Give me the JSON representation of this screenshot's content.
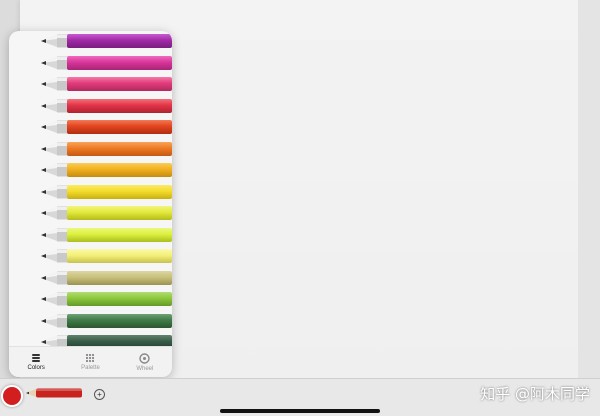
{
  "palette": {
    "pencils": [
      {
        "color": "#a02aa6",
        "light": "#c85ad0",
        "dark": "#7a1d80"
      },
      {
        "color": "#d8359a",
        "light": "#ee6cbc",
        "dark": "#a82476"
      },
      {
        "color": "#e23a7c",
        "light": "#f47aa4",
        "dark": "#b02a5e"
      },
      {
        "color": "#e23448",
        "light": "#f2707a",
        "dark": "#b0222f"
      },
      {
        "color": "#e2441f",
        "light": "#f27a56",
        "dark": "#b02e10"
      },
      {
        "color": "#ef7a24",
        "light": "#f7a45a",
        "dark": "#c35a12"
      },
      {
        "color": "#f2b01f",
        "light": "#f8cd5a",
        "dark": "#c48c10"
      },
      {
        "color": "#f4dc2a",
        "light": "#f9ea6a",
        "dark": "#c8b014"
      },
      {
        "color": "#e4ea3a",
        "light": "#f1f47e",
        "dark": "#b4ba1c"
      },
      {
        "color": "#dcf03e",
        "light": "#ecf87e",
        "dark": "#aabe20"
      },
      {
        "color": "#f4f07a",
        "light": "#fafaa8",
        "dark": "#c8c24e"
      },
      {
        "color": "#c8c07a",
        "light": "#dcd6a2",
        "dark": "#9a9252"
      },
      {
        "color": "#8cc83a",
        "light": "#b2dc74",
        "dark": "#64982a"
      },
      {
        "color": "#3f7a46",
        "light": "#6ea276",
        "dark": "#2a5630"
      },
      {
        "color": "#385c48",
        "light": "#62846e",
        "dark": "#223e30"
      }
    ]
  },
  "tabs": [
    {
      "label": "Colors",
      "icon": "stack-icon",
      "active": true
    },
    {
      "label": "Palette",
      "icon": "grid-dots-icon",
      "active": false
    },
    {
      "label": "Wheel",
      "icon": "color-wheel-icon",
      "active": false
    }
  ],
  "toolbar": {
    "current_color": "#d21e1e",
    "pencil_color": "#c8231e",
    "add_label": "+"
  },
  "watermark": {
    "text": "知乎 @阿木同学"
  }
}
